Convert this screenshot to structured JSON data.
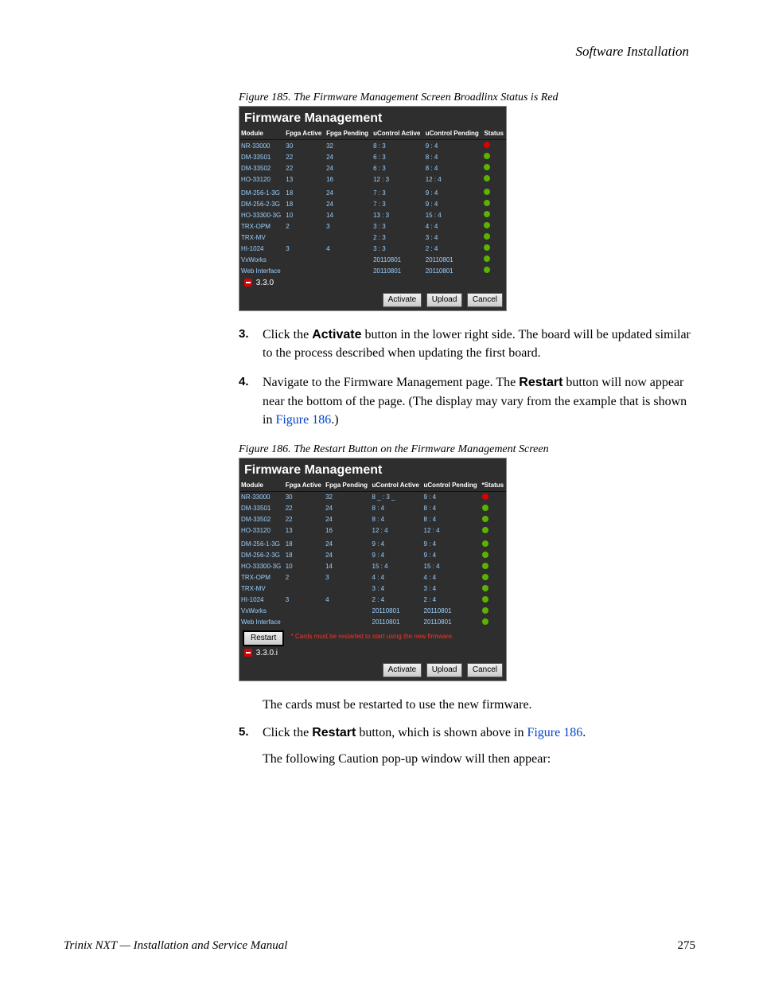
{
  "header": "Software Installation",
  "figure185": {
    "caption": "Figure 185.  The Firmware Management Screen Broadlinx Status is Red",
    "title": "Firmware Management",
    "cols": [
      "Module",
      "Fpga Active",
      "Fpga Pending",
      "uControl Active",
      "uControl Pending",
      "Status"
    ],
    "rows": [
      {
        "m": "NR-33000",
        "fa": "30",
        "fp": "32",
        "ua": "8 : 3",
        "up": "9 : 4",
        "st": "red"
      },
      {
        "m": "DM-33501",
        "fa": "22",
        "fp": "24",
        "ua": "6 : 3",
        "up": "8 : 4",
        "st": "green"
      },
      {
        "m": "DM-33502",
        "fa": "22",
        "fp": "24",
        "ua": "6 : 3",
        "up": "8 : 4",
        "st": "green"
      },
      {
        "m": "HO-33120",
        "fa": "13",
        "fp": "16",
        "ua": "12 : 3",
        "up": "12 : 4",
        "st": "green"
      },
      {
        "m": "DM-256-1-3G",
        "fa": "18",
        "fp": "24",
        "ua": "7 : 3",
        "up": "9 : 4",
        "st": "green",
        "sec": true
      },
      {
        "m": "DM-256-2-3G",
        "fa": "18",
        "fp": "24",
        "ua": "7 : 3",
        "up": "9 : 4",
        "st": "green"
      },
      {
        "m": "HO-33300-3G",
        "fa": "10",
        "fp": "14",
        "ua": "13 : 3",
        "up": "15 : 4",
        "st": "green"
      },
      {
        "m": "TRX-OPM",
        "fa": "2",
        "fp": "3",
        "ua": "3 : 3",
        "up": "4 : 4",
        "st": "green"
      },
      {
        "m": "TRX-MV",
        "fa": "",
        "fp": "",
        "ua": "2 : 3",
        "up": "3 : 4",
        "st": "green"
      },
      {
        "m": "HI-1024",
        "fa": "3",
        "fp": "4",
        "ua": "3 : 3",
        "up": "2 : 4",
        "st": "green"
      },
      {
        "m": "VxWorks",
        "fa": "",
        "fp": "",
        "ua": "20110801",
        "up": "20110801",
        "st": "green"
      },
      {
        "m": "Web Interface",
        "fa": "",
        "fp": "",
        "ua": "20110801",
        "up": "20110801",
        "st": "green"
      }
    ],
    "version": "3.3.0",
    "buttons": {
      "activate": "Activate",
      "upload": "Upload",
      "cancel": "Cancel"
    }
  },
  "step3": {
    "num": "3",
    "p1a": "Click the ",
    "p1b": "Activate",
    "p1c": " button in the lower right side. The board will be updated similar to the process described when updating the first board."
  },
  "step4": {
    "num": "4",
    "p1a": "Navigate to the Firmware Management page. The ",
    "p1b": "Restart",
    "p1c": " button will now appear near the bottom of the page. (The display may vary from the example that is shown in ",
    "p1d": "Figure 186",
    "p1e": ".)"
  },
  "figure186": {
    "caption": "Figure 186.  The Restart Button on the Firmware Management Screen",
    "title": "Firmware Management",
    "cols": [
      "Module",
      "Fpga Active",
      "Fpga Pending",
      "uControl Active",
      "uControl Pending",
      "*Status"
    ],
    "rows": [
      {
        "m": "NR-33000",
        "fa": "30",
        "fp": "32",
        "ua": "8 _ : 3 _",
        "up": "9 : 4",
        "st": "red"
      },
      {
        "m": "DM-33501",
        "fa": "22",
        "fp": "24",
        "ua": "8 : 4",
        "up": "8 : 4",
        "st": "green"
      },
      {
        "m": "DM-33502",
        "fa": "22",
        "fp": "24",
        "ua": "8 : 4",
        "up": "8 : 4",
        "st": "green"
      },
      {
        "m": "HO-33120",
        "fa": "13",
        "fp": "16",
        "ua": "12 : 4",
        "up": "12 : 4",
        "st": "green"
      },
      {
        "m": "DM-256-1-3G",
        "fa": "18",
        "fp": "24",
        "ua": "9 : 4",
        "up": "9 : 4",
        "st": "green",
        "sec": true
      },
      {
        "m": "DM-256-2-3G",
        "fa": "18",
        "fp": "24",
        "ua": "9 : 4",
        "up": "9 : 4",
        "st": "green"
      },
      {
        "m": "HO-33300-3G",
        "fa": "10",
        "fp": "14",
        "ua": "15 : 4",
        "up": "15 : 4",
        "st": "green"
      },
      {
        "m": "TRX-OPM",
        "fa": "2",
        "fp": "3",
        "ua": "4 : 4",
        "up": "4 : 4",
        "st": "green"
      },
      {
        "m": "TRX-MV",
        "fa": "",
        "fp": "",
        "ua": "3 : 4",
        "up": "3 : 4",
        "st": "green"
      },
      {
        "m": "HI-1024",
        "fa": "3",
        "fp": "4",
        "ua": "2 : 4",
        "up": "2 : 4",
        "st": "green"
      },
      {
        "m": "VxWorks",
        "fa": "",
        "fp": "",
        "ua": "20110801",
        "up": "20110801",
        "st": "green"
      },
      {
        "m": "Web Interface",
        "fa": "",
        "fp": "",
        "ua": "20110801",
        "up": "20110801",
        "st": "green"
      }
    ],
    "restart_label": "Restart",
    "restart_msg": "* Cards must be restarted to start using the new firmware.",
    "version": "3.3.0.i",
    "buttons": {
      "activate": "Activate",
      "upload": "Upload",
      "cancel": "Cancel"
    }
  },
  "para_after": "The cards must be restarted to use the new firmware.",
  "step5": {
    "num": "5",
    "p1a": "Click the ",
    "p1b": "Restart",
    "p1c": " button, which is shown above in ",
    "p1d": "Figure 186",
    "p1e": ".",
    "p2": "The following Caution pop-up window will then appear:"
  },
  "footer": {
    "left": "Trinix NXT  —  Installation and Service Manual",
    "right": "275"
  }
}
